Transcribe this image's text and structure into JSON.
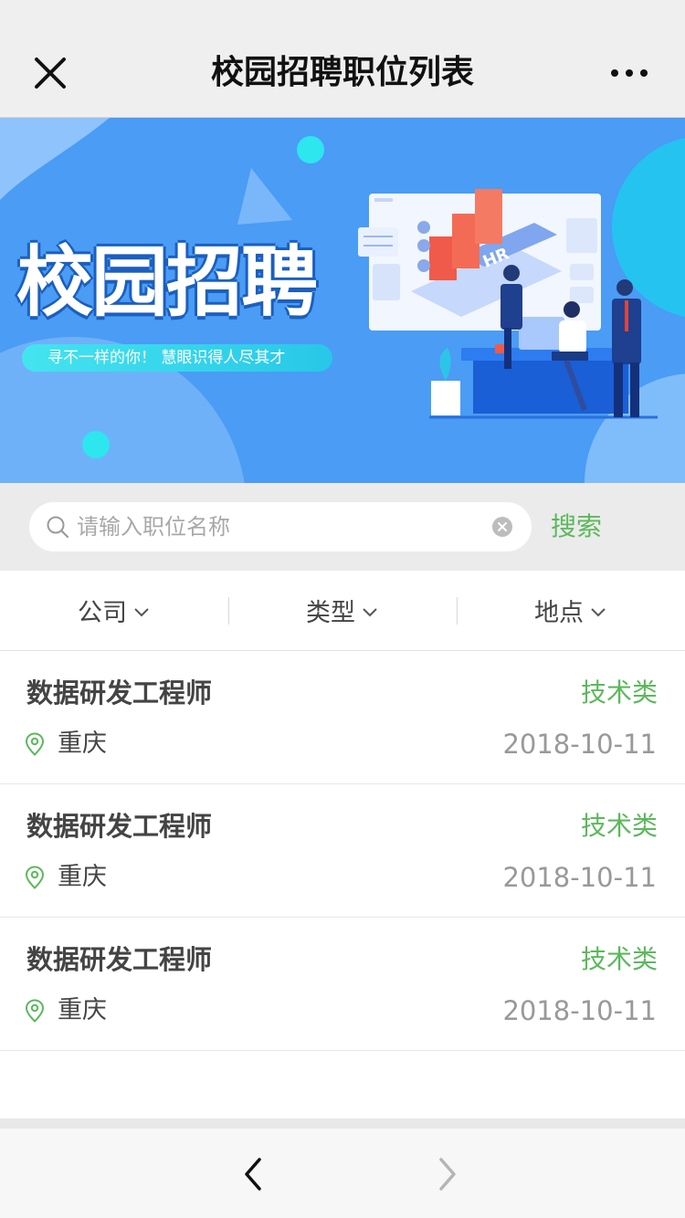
{
  "navbar": {
    "title": "校园招聘职位列表",
    "close_icon": "close-icon",
    "more_icon": "more-icon"
  },
  "banner": {
    "title": "校园招聘",
    "slogan": "寻不一样的你！ 慧眼识得人尽其才",
    "sign_text": "HR"
  },
  "search": {
    "placeholder": "请输入职位名称",
    "value": "",
    "button_label": "搜索"
  },
  "filters": [
    {
      "label": "公司"
    },
    {
      "label": "类型"
    },
    {
      "label": "地点"
    }
  ],
  "jobs": [
    {
      "title": "数据研发工程师",
      "type": "技术类",
      "city": "重庆",
      "date": "2018-10-11"
    },
    {
      "title": "数据研发工程师",
      "type": "技术类",
      "city": "重庆",
      "date": "2018-10-11"
    },
    {
      "title": "数据研发工程师",
      "type": "技术类",
      "city": "重庆",
      "date": "2018-10-11"
    }
  ],
  "colors": {
    "accent": "#5cb85c",
    "banner_bg": "#4a9cf5",
    "text": "#444444",
    "muted": "#999999"
  }
}
